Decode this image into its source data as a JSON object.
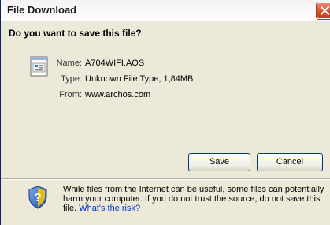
{
  "window": {
    "title": "File Download"
  },
  "dialog": {
    "question": "Do you want to save this file?",
    "file": {
      "name_label": "Name:",
      "name_value": "A704WIFI.AOS",
      "type_label": "Type:",
      "type_value": "Unknown File Type, 1,84MB",
      "from_label": "From:",
      "from_value": "www.archos.com"
    },
    "buttons": {
      "save": "Save",
      "cancel": "Cancel"
    },
    "warning": {
      "text": "While files from the Internet can be useful, some files can potentially harm your computer. If you do not trust the source, do not save this file.",
      "link": "What's the risk?"
    }
  },
  "icons": {
    "close": "close-icon",
    "file": "unknown-file-icon",
    "shield": "security-shield-icon"
  },
  "colors": {
    "dialog_background": "#ece9d8",
    "link": "#0033cc",
    "close_button": "#d3502d"
  }
}
